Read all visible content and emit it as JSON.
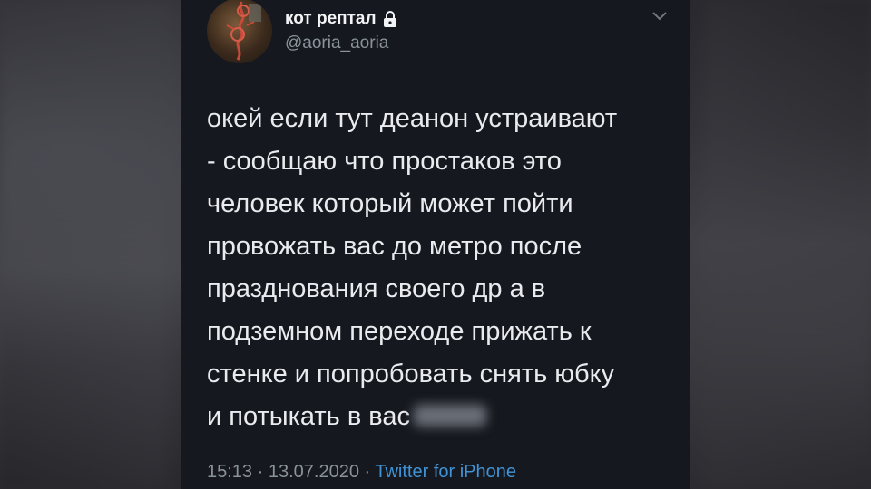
{
  "tweet": {
    "display_name": "кот рептал",
    "handle": "@aoria_aoria",
    "text_lines": [
      "окей если тут деанон устраивают",
      "- сообщаю что простаков это",
      "человек который может пойти",
      "провожать вас до метро после",
      "празднования своего др а в",
      "подземном переходе прижать к",
      "стенке и попробовать снять юбку",
      "и потыкать в вас"
    ],
    "time": "15:13",
    "separator": " · ",
    "date": "13.07.2020",
    "source": "Twitter for iPhone"
  },
  "icons": {
    "lock": "lock-icon",
    "more": "chevron-down-icon",
    "avatar": "avatar"
  },
  "colors": {
    "card_bg": "#15181e",
    "text": "#e9ebee",
    "muted": "#8a939c",
    "link": "#3f93d6"
  }
}
